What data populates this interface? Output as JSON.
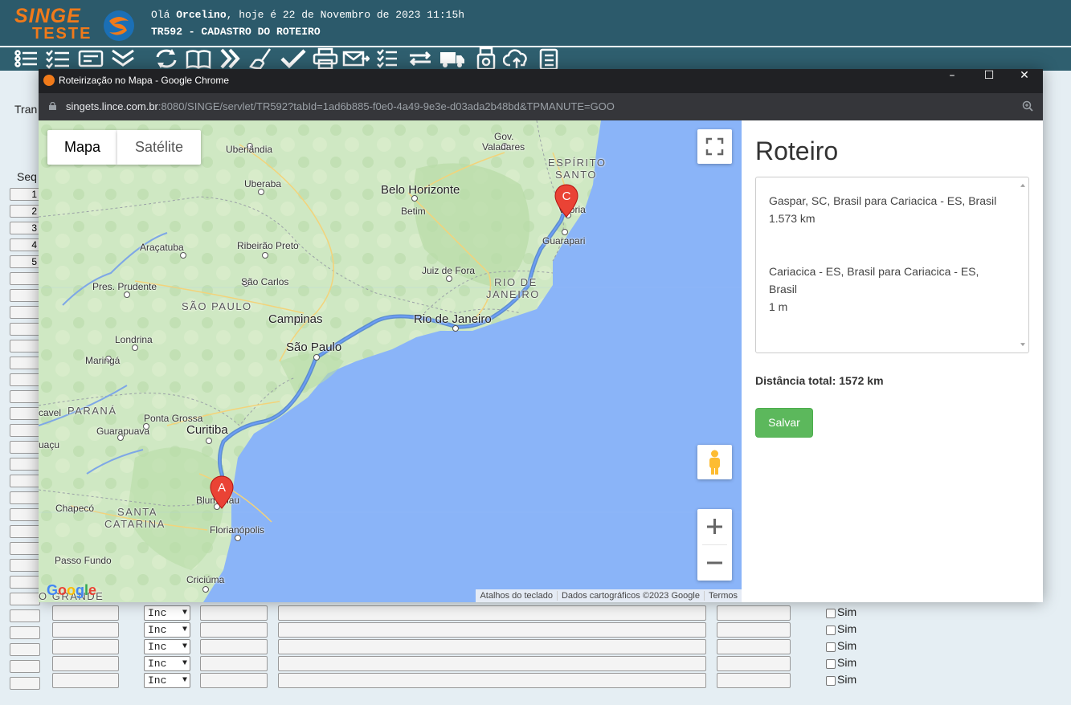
{
  "app": {
    "logo_line1": "SINGE",
    "logo_line2": "TESTE",
    "greeting_prefix": "Olá",
    "user": "Orcelino",
    "greeting_suffix": ", hoje é 22 de Novembro de 2023 11:15h",
    "screen_title": "TR592 - CADASTRO DO ROTEIRO"
  },
  "toolbar_icons": [
    "list-icon",
    "checklist-icon",
    "card-icon",
    "double-chevron-down-icon",
    "refresh-icon",
    "book-icon",
    "fast-forward-icon",
    "broom-icon",
    "check-icon",
    "printer-icon",
    "email-send-icon",
    "task-list-icon",
    "transfer-icon",
    "truck-icon",
    "usb-drive-icon",
    "cloud-upload-icon",
    "clipboard-icon"
  ],
  "background_form": {
    "label_tran": "Tran",
    "label_seq": "Seq",
    "row_numbers": [
      "1",
      "2",
      "3",
      "4",
      "5"
    ],
    "select_value": "Inc",
    "checkbox_label": "Sim"
  },
  "browser": {
    "window_title": "Roteirização no Mapa - Google Chrome",
    "url_host": "singets.lince.com.br",
    "url_rest": ":8080/SINGE/servlet/TR592?tabId=1ad6b885-f0e0-4a49-9e3e-d03ada2b48bd&TPMANUTE=GOO"
  },
  "map": {
    "tab_map": "Mapa",
    "tab_satellite": "Satélite",
    "marker_a": "A",
    "marker_c": "C",
    "cities": {
      "gov_valadares_1": "Gov.",
      "gov_valadares_2": "Valadares",
      "uberlandia": "Uberlândia",
      "uberaba": "Uberaba",
      "belo_horizonte": "Belo Horizonte",
      "betim": "Betim",
      "vitoria": "Vitória",
      "guarapari": "Guarapari",
      "aracatuba": "Araçatuba",
      "ribeirao_preto": "Ribeirão Preto",
      "juiz_de_fora": "Juiz de Fora",
      "pres_prudente": "Pres. Prudente",
      "sao_carlos": "São Carlos",
      "campinas": "Campinas",
      "rio_de_janeiro": "Rio de Janeiro",
      "londrina": "Londrina",
      "sao_paulo": "São Paulo",
      "maringa": "Maringá",
      "cascavel": "cavel",
      "ponta_grossa": "Ponta Grossa",
      "guarapuava": "Guarapuava",
      "curitiba": "Curitiba",
      "iguacu": "uaçu",
      "chapeco": "Chapecó",
      "blumenau": "Blumenau",
      "florianopolis": "Florianópolis",
      "passo_fundo": "Passo Fundo",
      "criciuma": "Criciúma"
    },
    "states": {
      "espirito_santo_1": "ESPÍRITO",
      "espirito_santo_2": "SANTO",
      "rio_de_janeiro_1": "RIO DE",
      "rio_de_janeiro_2": "JANEIRO",
      "sao_paulo": "SÃO PAULO",
      "parana": "PARANÁ",
      "santa_catarina_1": "SANTA",
      "santa_catarina_2": "CATARINA",
      "rio_grande": "O GRANDE"
    },
    "google_logo": "Google",
    "attribution": [
      "Atalhos do teclado",
      "Dados cartográficos ©2023 Google",
      "Termos"
    ]
  },
  "panel": {
    "title": "Roteiro",
    "legs": [
      {
        "text": "Gaspar, SC, Brasil para Cariacica - ES, Brasil",
        "distance": "1.573 km"
      },
      {
        "text": "Cariacica - ES, Brasil para Cariacica - ES, Brasil",
        "distance": "1 m"
      }
    ],
    "total_label": "Distância total:",
    "total_value": "1572 km",
    "save_button": "Salvar"
  }
}
